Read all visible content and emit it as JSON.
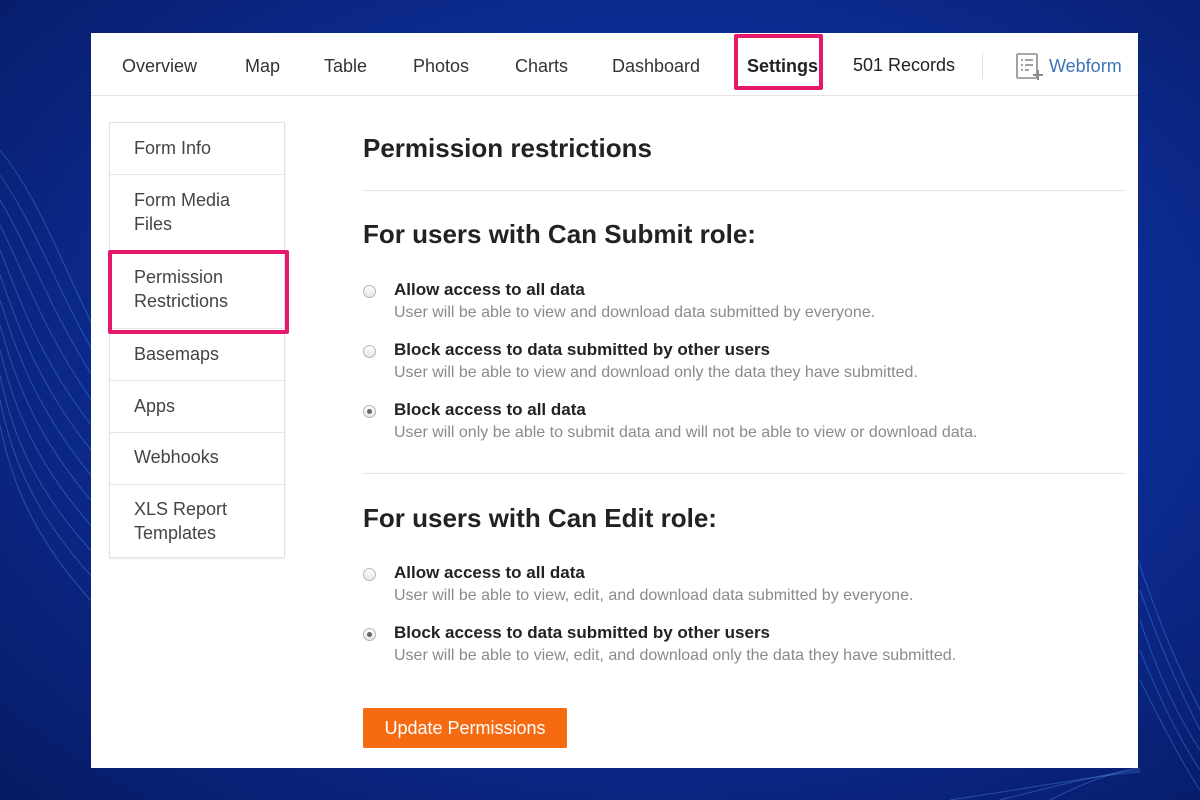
{
  "nav": {
    "tabs": [
      {
        "label": "Overview"
      },
      {
        "label": "Map"
      },
      {
        "label": "Table"
      },
      {
        "label": "Photos"
      },
      {
        "label": "Charts"
      },
      {
        "label": "Dashboard"
      },
      {
        "label": "Settings",
        "active": true
      }
    ],
    "records": "501 Records",
    "webform_label": "Webform",
    "webform_icon": "form-add-icon"
  },
  "sidebar": {
    "items": [
      {
        "line1": "Form Info",
        "line2": ""
      },
      {
        "line1": "Form Media",
        "line2": "Files"
      },
      {
        "line1": "Permission",
        "line2": "Restrictions",
        "active": true
      },
      {
        "line1": "Basemaps",
        "line2": ""
      },
      {
        "line1": "Apps",
        "line2": ""
      },
      {
        "line1": "Webhooks",
        "line2": ""
      },
      {
        "line1": "XLS Report",
        "line2": "Templates"
      }
    ]
  },
  "main": {
    "title": "Permission restrictions",
    "sections": [
      {
        "title": "For users with Can Submit role:",
        "options": [
          {
            "label": "Allow access to all data",
            "desc": "User will be able to view and download data submitted by everyone.",
            "checked": false
          },
          {
            "label": "Block access to data submitted by other users",
            "desc": "User will be able to view and download only the data they have submitted.",
            "checked": false
          },
          {
            "label": "Block access to all data",
            "desc": "User will only be able to submit data and will not be able to view or download data.",
            "checked": true
          }
        ]
      },
      {
        "title": "For users with Can Edit role:",
        "options": [
          {
            "label": "Allow access to all data",
            "desc": "User will be able to view, edit, and download data submitted by everyone.",
            "checked": false
          },
          {
            "label": "Block access to data submitted by other users",
            "desc": "User will be able to view, edit, and download only the data they have submitted.",
            "checked": true
          }
        ]
      }
    ],
    "button_label": "Update Permissions"
  },
  "colors": {
    "highlight": "#e6186b",
    "accent_button": "#f66a12",
    "link": "#3b74b8",
    "background": "#0d2f9a"
  }
}
